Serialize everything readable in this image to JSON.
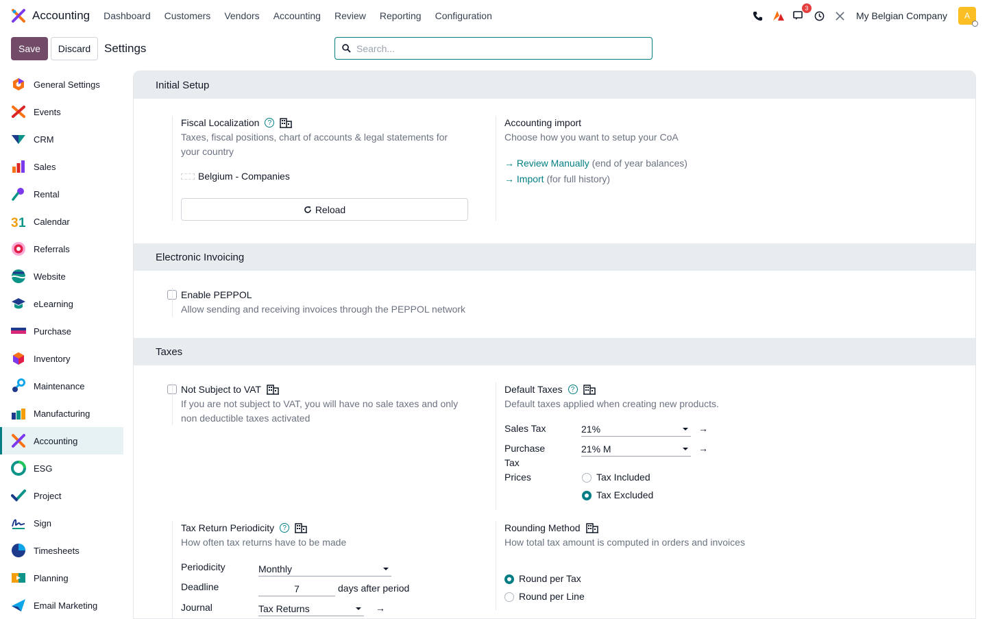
{
  "topbar": {
    "app_name": "Accounting",
    "menu": [
      "Dashboard",
      "Customers",
      "Vendors",
      "Accounting",
      "Review",
      "Reporting",
      "Configuration"
    ],
    "messages_count": "3",
    "company": "My Belgian Company",
    "avatar_letter": "A",
    "icons": [
      "phone-icon",
      "activity-icon",
      "chat-icon",
      "clock-icon",
      "tools-icon"
    ]
  },
  "controls": {
    "save": "Save",
    "discard": "Discard",
    "title": "Settings",
    "search_placeholder": "Search..."
  },
  "sidebar": {
    "items": [
      {
        "label": "General Settings",
        "icon": "general-settings-icon"
      },
      {
        "label": "Events",
        "icon": "events-icon"
      },
      {
        "label": "CRM",
        "icon": "crm-icon"
      },
      {
        "label": "Sales",
        "icon": "sales-icon"
      },
      {
        "label": "Rental",
        "icon": "rental-icon"
      },
      {
        "label": "Calendar",
        "icon": "calendar-icon"
      },
      {
        "label": "Referrals",
        "icon": "referrals-icon"
      },
      {
        "label": "Website",
        "icon": "website-icon"
      },
      {
        "label": "eLearning",
        "icon": "elearning-icon"
      },
      {
        "label": "Purchase",
        "icon": "purchase-icon"
      },
      {
        "label": "Inventory",
        "icon": "inventory-icon"
      },
      {
        "label": "Maintenance",
        "icon": "maintenance-icon"
      },
      {
        "label": "Manufacturing",
        "icon": "manufacturing-icon"
      },
      {
        "label": "Accounting",
        "icon": "accounting-icon",
        "active": true
      },
      {
        "label": "ESG",
        "icon": "esg-icon"
      },
      {
        "label": "Project",
        "icon": "project-icon"
      },
      {
        "label": "Sign",
        "icon": "sign-icon"
      },
      {
        "label": "Timesheets",
        "icon": "timesheets-icon"
      },
      {
        "label": "Planning",
        "icon": "planning-icon"
      },
      {
        "label": "Email Marketing",
        "icon": "email-marketing-icon"
      }
    ]
  },
  "sections": {
    "initial_setup": {
      "title": "Initial Setup",
      "fiscal": {
        "title": "Fiscal Localization",
        "desc": "Taxes, fiscal positions, chart of accounts & legal statements for your country",
        "value": "Belgium - Companies",
        "reload": "Reload"
      },
      "import": {
        "title": "Accounting import",
        "desc": "Choose how you want to setup your CoA",
        "link1": "Review Manually",
        "link1_note": "(end of year balances)",
        "link2": "Import",
        "link2_note": "(for full history)"
      }
    },
    "einvoicing": {
      "title": "Electronic Invoicing",
      "peppol": {
        "title": "Enable PEPPOL",
        "desc": "Allow sending and receiving invoices through the PEPPOL network",
        "checked": false
      }
    },
    "taxes": {
      "title": "Taxes",
      "not_vat": {
        "title": "Not Subject to VAT",
        "desc": "If you are not subject to VAT, you will have no sale taxes and only non deductible taxes activated",
        "checked": false
      },
      "default_taxes": {
        "title": "Default Taxes",
        "desc": "Default taxes applied when creating new products.",
        "sales_label": "Sales Tax",
        "sales_value": "21%",
        "purchase_label_1": "Purchase",
        "purchase_label_2": "Tax",
        "purchase_value": "21% M",
        "prices_label": "Prices",
        "opt_included": "Tax Included",
        "opt_excluded": "Tax Excluded",
        "selected": "Tax Excluded"
      },
      "periodicity": {
        "title": "Tax Return Periodicity",
        "desc": "How often tax returns have to be made",
        "periodicity_label": "Periodicity",
        "periodicity_value": "Monthly",
        "deadline_label": "Deadline",
        "deadline_value": "7",
        "deadline_suffix": "days after period",
        "journal_label": "Journal",
        "journal_value": "Tax Returns"
      },
      "rounding": {
        "title": "Rounding Method",
        "desc": "How total tax amount is computed in orders and invoices",
        "opt_tax": "Round per Tax",
        "opt_line": "Round per Line",
        "selected": "Round per Tax"
      }
    }
  },
  "colors": {
    "primary": "#714b67",
    "accent": "#017e84"
  }
}
